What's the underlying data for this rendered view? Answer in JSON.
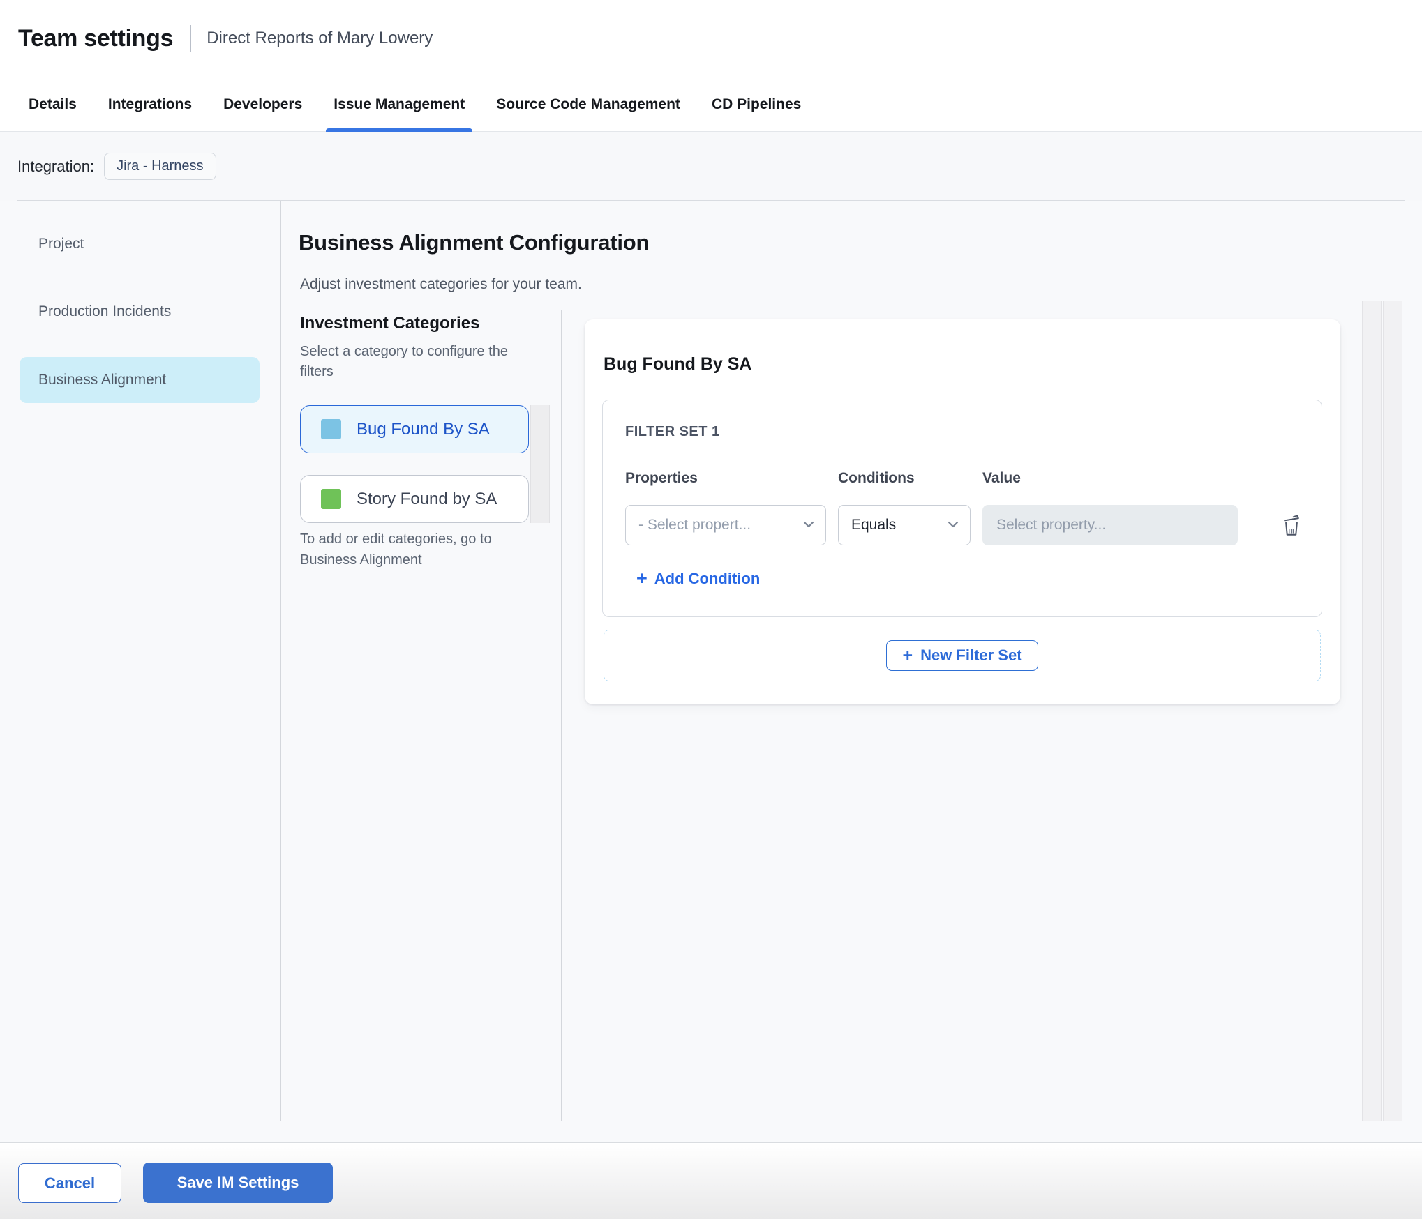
{
  "header": {
    "title": "Team settings",
    "subtitle": "Direct Reports of Mary Lowery"
  },
  "tabs": {
    "items": [
      {
        "label": "Details",
        "active": false
      },
      {
        "label": "Integrations",
        "active": false
      },
      {
        "label": "Developers",
        "active": false
      },
      {
        "label": "Issue Management",
        "active": true
      },
      {
        "label": "Source Code Management",
        "active": false
      },
      {
        "label": "CD Pipelines",
        "active": false
      }
    ]
  },
  "integration": {
    "label": "Integration:",
    "chip": "Jira - Harness"
  },
  "sidebar": {
    "items": [
      {
        "label": "Project",
        "active": false
      },
      {
        "label": "Production Incidents",
        "active": false
      },
      {
        "label": "Business Alignment",
        "active": true
      }
    ]
  },
  "main": {
    "heading": "Business Alignment Configuration",
    "subheading": "Adjust investment categories for your team.",
    "categories": {
      "title": "Investment Categories",
      "subtitle": "Select a category to configure the filters",
      "items": [
        {
          "label": "Bug Found By SA",
          "swatch_color": "#7cc3e4",
          "swatch_style": "background:#7cc3e4",
          "selected": true
        },
        {
          "label": "Story Found by SA",
          "swatch_color": "#6fc258",
          "swatch_style": "background:#6fc258",
          "selected": false
        }
      ],
      "note": "To add or edit categories, go to Business Alignment"
    }
  },
  "panel": {
    "title": "Bug Found By SA",
    "filter_set": {
      "label": "FILTER SET 1",
      "columns": [
        "Properties",
        "Conditions",
        "Value"
      ],
      "row": {
        "property_placeholder": "- Select propert...",
        "condition_value": "Equals",
        "value_placeholder": "Select property..."
      },
      "add_condition_label": "Add Condition"
    },
    "new_filter_set_label": "New Filter Set"
  },
  "footer": {
    "cancel_label": "Cancel",
    "save_label": "Save IM Settings"
  },
  "icons": {
    "plus": "+"
  },
  "colors": {
    "accent_blue": "#2e6fe0",
    "link_blue": "#2767e4",
    "save_button_fill": "#3b72cf",
    "active_tab_underline": "#3775e3",
    "selected_category_border": "#2a68d8",
    "selected_category_bg": "#eaf6fd",
    "selected_category_text": "#1d54c8",
    "sidebar_active_pill_bg": "#cdeef9",
    "bug_swatch": "#7cc3e4",
    "story_swatch": "#6fc258",
    "value_input_bg": "#e7ebee",
    "dashed_border": "#b5dcf4",
    "content_bg": "#f8f9fb"
  }
}
